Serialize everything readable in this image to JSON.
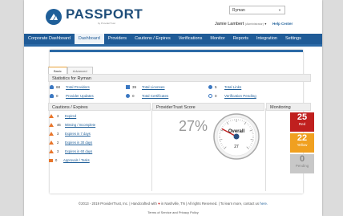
{
  "brand": {
    "name": "PASSPORT",
    "sub": "by ProviderTrust"
  },
  "org_select": {
    "value": "Ryman"
  },
  "user": {
    "name": "Jamie Lambert",
    "role": "(Administrator)",
    "help": "Help Center"
  },
  "nav": [
    "Corporate Dashboard",
    "Dashboard",
    "Providers",
    "Cautions / Expires",
    "Verifications",
    "Monitor",
    "Reports",
    "Integration",
    "Settings"
  ],
  "tabs": [
    "Basic",
    "Advanced"
  ],
  "stats": {
    "title": "Statistics for Ryman",
    "items": [
      {
        "num": "68",
        "label": "Total Providers"
      },
      {
        "num": "39",
        "label": "Total Licenses"
      },
      {
        "num": "5",
        "label": "Total Links"
      },
      {
        "num": "0",
        "label": "Provider Updates"
      },
      {
        "num": "0",
        "label": "Total Certificates"
      },
      {
        "num": "0",
        "label": "Verification Pending"
      }
    ]
  },
  "cautions": {
    "title": "Cautions / Expires",
    "rows": [
      {
        "num": "3",
        "label": "Expired"
      },
      {
        "num": "46",
        "label": "Missing / Incomplete"
      },
      {
        "num": "3",
        "label": "Expires in 7 days"
      },
      {
        "num": "2",
        "label": "Expires in 30 days"
      },
      {
        "num": "3",
        "label": "Expires in 60 days"
      },
      {
        "num": "0",
        "label": "Approvals / Tasks"
      }
    ]
  },
  "score": {
    "title": "ProviderTrust Score",
    "percent": "27%",
    "gauge_label": "Overall",
    "gauge_value": "27",
    "gauge_fraction": 0.27
  },
  "monitoring": {
    "title": "Monitoring",
    "red": {
      "num": "25",
      "label": "Red",
      "color": "#c0201f"
    },
    "yellow": {
      "num": "22",
      "label": "Yellow",
      "color": "#f0a020"
    },
    "pending": {
      "num": "0",
      "label": "Pending",
      "color": "#c8c8c8"
    }
  },
  "footer": {
    "line1_a": "©2013 - 2019 ProviderTrust, Inc.  |  Handcrafted with",
    "line1_b": "in Nashville, TN  |  All rights Reserved.  |  To learn more, contact us",
    "here": "here.",
    "line2": "Terms of Service and Privacy Policy"
  }
}
